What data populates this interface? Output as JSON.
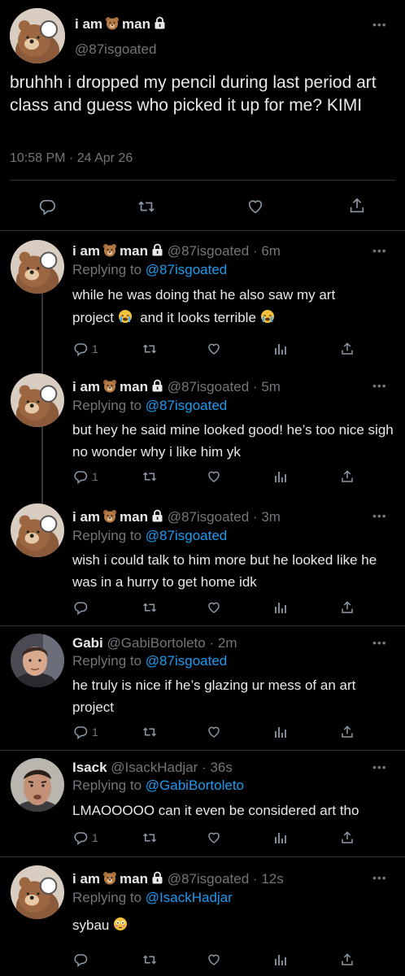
{
  "main_tweet": {
    "display_name_a": "i am",
    "display_name_b": "man",
    "handle": "@87isgoated",
    "text": "bruhhh i dropped my pencil during last period art class and guess who picked it up for me? KIMI",
    "time": "10:58 PM",
    "sep": "·",
    "date": "24 Apr 26"
  },
  "replies": [
    {
      "name_a": "i am",
      "name_b": "man",
      "handle": "@87isgoated",
      "sep": "·",
      "time": "6m",
      "replying_label": "Replying to",
      "replying_to": "@87isgoated",
      "text1": "while he was doing that he also saw my art",
      "text2": "project",
      "text3": "and it looks terrible",
      "replies": "1"
    },
    {
      "name_a": "i am",
      "name_b": "man",
      "handle": "@87isgoated",
      "sep": "·",
      "time": "5m",
      "replying_label": "Replying to",
      "replying_to": "@87isgoated",
      "text": "but hey he said mine looked good! he’s too nice sigh no wonder why i like him yk",
      "replies": "1"
    },
    {
      "name_a": "i am",
      "name_b": "man",
      "handle": "@87isgoated",
      "sep": "·",
      "time": "3m",
      "replying_label": "Replying to",
      "replying_to": "@87isgoated",
      "text": "wish i could talk to him more but he looked like he was in a hurry to get home idk"
    },
    {
      "name": "Gabi",
      "handle": "@GabiBortoleto",
      "sep": "·",
      "time": "2m",
      "replying_label": "Replying to",
      "replying_to": "@87isgoated",
      "text": "he truly is nice if he’s glazing ur mess of an art project",
      "replies": "1"
    },
    {
      "name": "Isack",
      "handle": "@IsackHadjar",
      "sep": "·",
      "time": "36s",
      "replying_label": "Replying to",
      "replying_to": "@GabiBortoleto",
      "text": "LMAOOOOO can it even be considered art tho",
      "replies": "1"
    },
    {
      "name_a": "i am",
      "name_b": "man",
      "handle": "@87isgoated",
      "sep": "·",
      "time": "12s",
      "replying_label": "Replying to",
      "replying_to": "@IsackHadjar",
      "text": "sybau"
    }
  ],
  "icons": {
    "reply": "reply-icon",
    "retweet": "retweet-icon",
    "like": "heart-icon",
    "views": "views-icon",
    "share": "share-icon",
    "more": "more-icon",
    "lock": "lock-icon",
    "bear": "bear-emoji",
    "cry": "crying-emoji",
    "flushed": "flushed-emoji"
  },
  "colors": {
    "background": "#000000",
    "text": "#e7e9ea",
    "muted": "#71767b",
    "link": "#1d9bf0"
  }
}
